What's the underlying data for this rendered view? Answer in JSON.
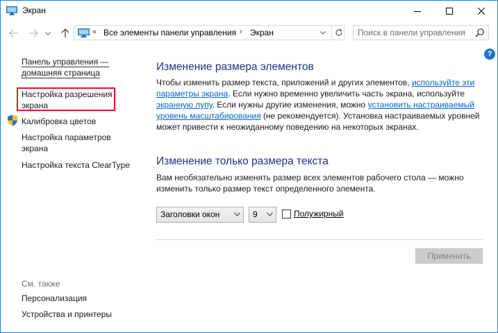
{
  "window": {
    "title": "Экран",
    "minimize_icon": "minimize-icon",
    "maximize_icon": "maximize-icon",
    "close_icon": "close-icon"
  },
  "nav": {
    "back_icon": "back-arrow-icon",
    "forward_icon": "forward-arrow-icon",
    "recent_icon": "chevron-down-icon",
    "up_icon": "up-arrow-icon"
  },
  "address": {
    "overflow": "«",
    "segment_1": "Все элементы панели управления",
    "separator": "›",
    "segment_2": "Экран"
  },
  "search": {
    "placeholder": "Поиск в панели управления"
  },
  "help": {
    "label": "?"
  },
  "sidebar": {
    "home": "Панель управления — домашняя страница",
    "resolution": "Настройка разрешения экрана",
    "calibration": "Калибровка цветов",
    "display_params": "Настройка параметров экрана",
    "cleartype": "Настройка текста ClearType",
    "see_also": "См. также",
    "personalization": "Персонализация",
    "devices": "Устройства и принтеры"
  },
  "main": {
    "section1": {
      "heading": "Изменение размера элементов",
      "text_1": "Чтобы изменить размер текста, приложений и других элементов, ",
      "link_1": "используйте эти параметры экрана",
      "text_2": ". Если нужно временно увеличить часть экрана, используйте ",
      "link_2": "экранную лупу",
      "text_3": ". Если нужны другие изменения, можно ",
      "link_3": "установить настраиваемый уровень масштабирования",
      "text_4": " (не рекомендуется). Установка настраиваемых уровней может привести к неожиданному поведению на некоторых экранах."
    },
    "section2": {
      "heading": "Изменение только размера текста",
      "description": "Вам необязательно изменять размер всех элементов рабочего стола — можно изменить только размер текст определенного элемента.",
      "element_select": "Заголовки окон",
      "size_select": "9",
      "bold_label": "Полужирный",
      "bold_checked": false
    },
    "apply_button": "Применить"
  },
  "colors": {
    "heading": "#1e3287",
    "link": "#0066cc",
    "highlight_border": "#e81123",
    "window_border": "#1883d7"
  }
}
